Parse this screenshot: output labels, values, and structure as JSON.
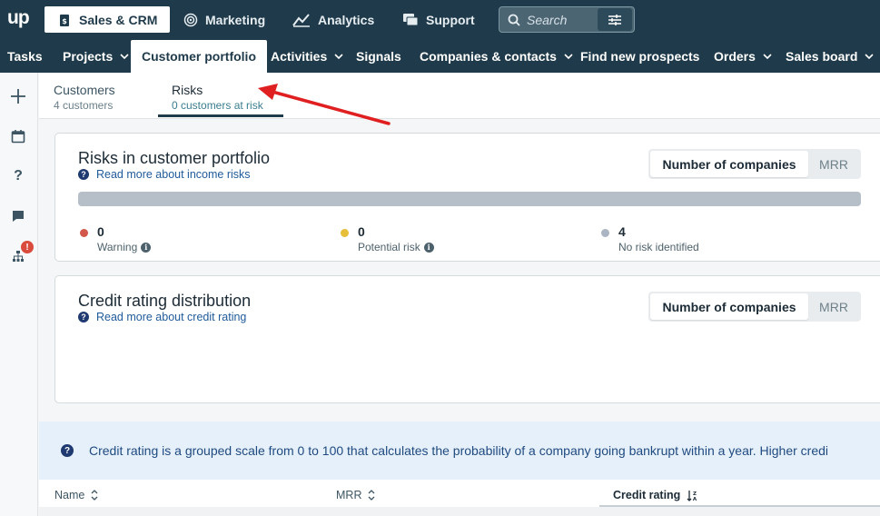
{
  "app": {
    "logo": "up"
  },
  "top_nav": {
    "items": [
      {
        "label": "Sales & CRM",
        "icon": "briefcase-icon"
      },
      {
        "label": "Marketing",
        "icon": "target-icon"
      },
      {
        "label": "Analytics",
        "icon": "chart-icon"
      },
      {
        "label": "Support",
        "icon": "chat-icon"
      }
    ],
    "search_placeholder": "Search"
  },
  "sub_nav": {
    "items": [
      {
        "label": "Tasks"
      },
      {
        "label": "Projects"
      },
      {
        "label": "Customer portfolio"
      },
      {
        "label": "Activities"
      },
      {
        "label": "Signals"
      },
      {
        "label": "Companies & contacts"
      },
      {
        "label": "Find new prospects"
      },
      {
        "label": "Orders"
      },
      {
        "label": "Sales board"
      }
    ]
  },
  "sidebar": {
    "icons": [
      "plus-icon",
      "calendar-icon",
      "help-icon",
      "chat-icon",
      "sitemap-icon"
    ],
    "alert_badge": "!"
  },
  "tabs": [
    {
      "label": "Customers",
      "sub": "4 customers"
    },
    {
      "label": "Risks",
      "sub": "0 customers at risk"
    }
  ],
  "risks_card": {
    "title": "Risks in customer portfolio",
    "help_link": "Read more about income risks",
    "toggle": {
      "active": "Number of companies",
      "inactive": "MRR"
    },
    "stats": [
      {
        "value": "0",
        "label": "Warning",
        "color": "#d0574a"
      },
      {
        "value": "0",
        "label": "Potential risk",
        "color": "#e6be3a"
      },
      {
        "value": "4",
        "label": "No risk identified",
        "color": "#aab4c2"
      }
    ]
  },
  "credit_card": {
    "title": "Credit rating distribution",
    "help_link": "Read more about credit rating",
    "toggle": {
      "active": "Number of companies",
      "inactive": "MRR"
    }
  },
  "banner": {
    "text": "Credit rating is a grouped scale from 0 to 100 that calculates the probability of a company going bankrupt within a year. Higher credi"
  },
  "table": {
    "columns": [
      "Name",
      "MRR",
      "Credit rating"
    ]
  },
  "colors": {
    "nav_bg": "#1f3a4a",
    "arrow": "#e02020"
  }
}
